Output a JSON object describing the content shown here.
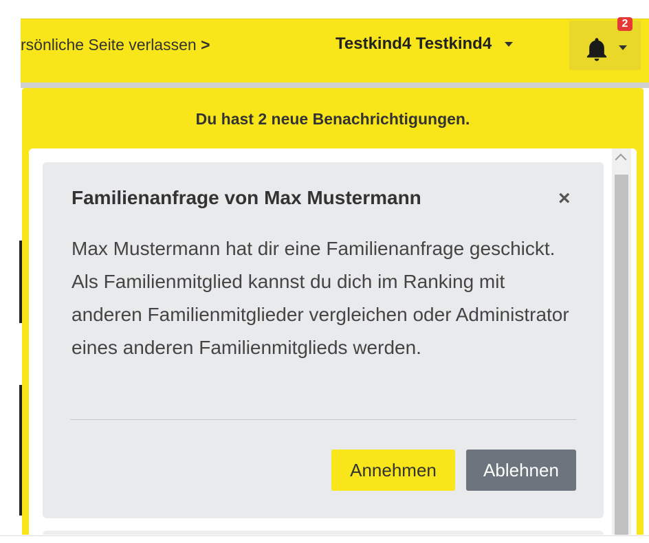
{
  "navbar": {
    "leave_link_text": "rsönliche Seite verlassen",
    "leave_link_arrow": ">",
    "user_name": "Testkind4 Testkind4",
    "notification_count": "2",
    "bell_icon": "bell-icon"
  },
  "dropdown": {
    "header": "Du hast 2 neue Benachrichtigungen.",
    "notifications": [
      {
        "title": "Familienanfrage von Max Mustermann",
        "close_label": "×",
        "body": "Max Mustermann hat dir eine Familienanfrage geschickt. Als Familienmitglied kannst du dich im Ranking mit anderen Familienmitglieder vergleichen oder Administrator eines anderen Familienmitglieds werden.",
        "accept_label": "Annehmen",
        "decline_label": "Ablehnen"
      }
    ]
  },
  "colors": {
    "accent_yellow": "#f8e61a",
    "badge_red": "#e53935",
    "decline_gray": "#6c757d",
    "card_bg": "#e9eaec"
  }
}
